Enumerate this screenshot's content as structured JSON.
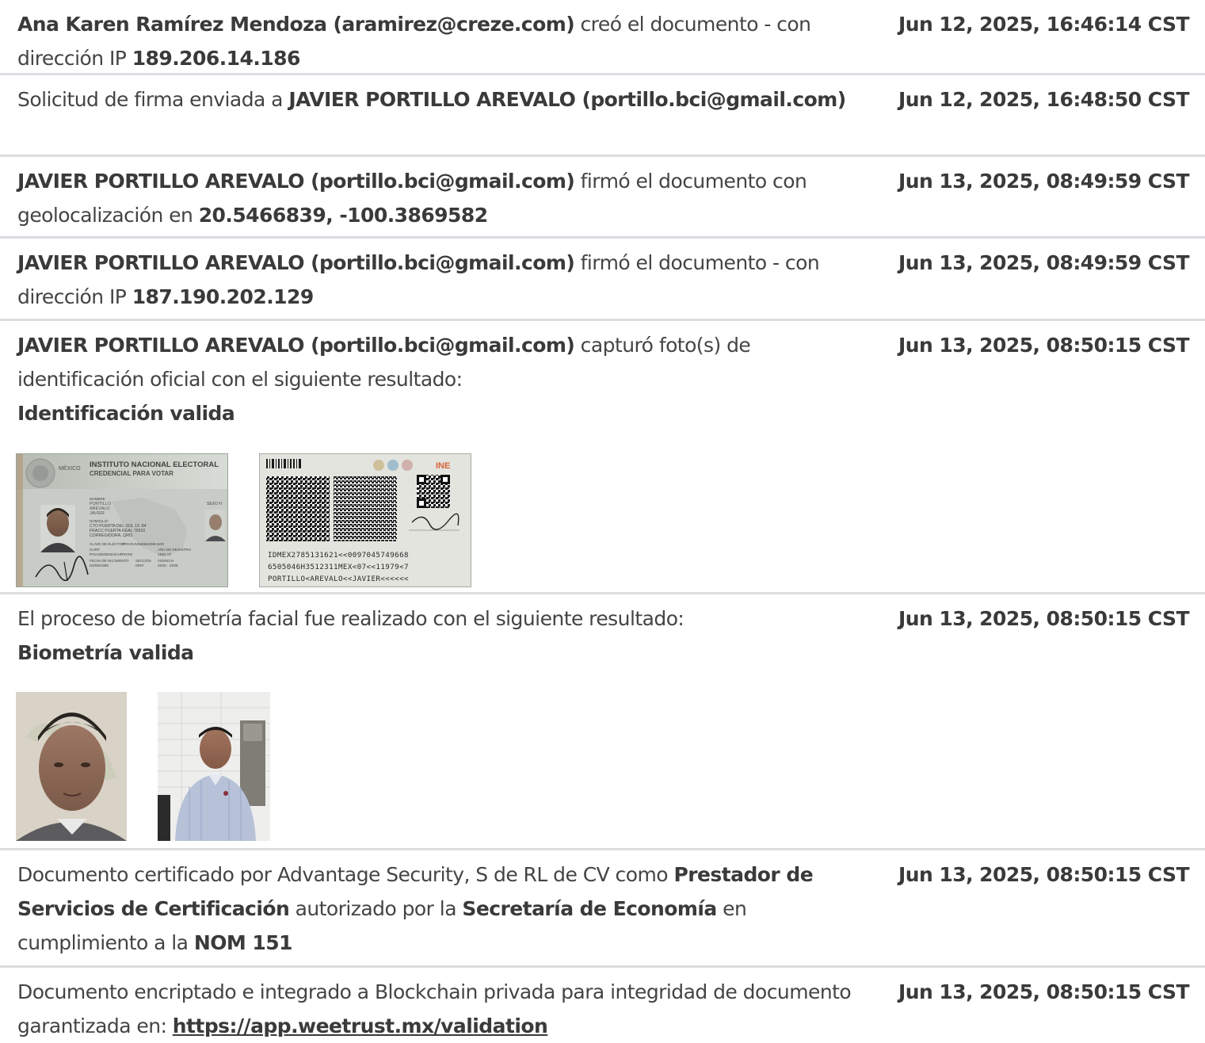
{
  "entries": [
    {
      "actor": "Ana Karen Ramírez Mendoza (aramirez@creze.com)",
      "action": " creó el documento - con dirección IP ",
      "ip": "189.206.14.186",
      "timestamp": "Jun 12, 2025, 16:46:14 CST"
    },
    {
      "action": "Solicitud de firma enviada a ",
      "recipient": "JAVIER PORTILLO AREVALO (portillo.bci@gmail.com)",
      "timestamp": "Jun 12, 2025, 16:48:50 CST"
    },
    {
      "actor": "JAVIER PORTILLO AREVALO (portillo.bci@gmail.com)",
      "action": " firmó el documento con geolocalización en ",
      "geo": "20.5466839, -100.3869582",
      "timestamp": "Jun 13, 2025, 08:49:59 CST"
    },
    {
      "actor": "JAVIER PORTILLO AREVALO (portillo.bci@gmail.com)",
      "action": " firmó el documento - con dirección IP ",
      "ip": "187.190.202.129",
      "timestamp": "Jun 13, 2025, 08:49:59 CST"
    },
    {
      "actor": "JAVIER PORTILLO AREVALO (portillo.bci@gmail.com)",
      "action": " capturó foto(s) de identificación oficial con el siguiente resultado:",
      "result": "Identificación valida",
      "timestamp": "Jun 13, 2025, 08:50:15 CST"
    },
    {
      "action": "El proceso de biometría facial fue realizado con el siguiente resultado:",
      "result": "Biometría valida",
      "timestamp": "Jun 13, 2025, 08:50:15 CST"
    },
    {
      "action_1": "Documento certificado por Advantage Security, S de RL de CV como ",
      "bold_1": "Prestador de Servicios de Certificación",
      "action_2": " autorizado por la ",
      "bold_2": "Secretaría de Economía",
      "action_3": " en cumplimiento a la ",
      "bold_3": "NOM 151",
      "timestamp": "Jun 13, 2025, 08:50:15 CST"
    },
    {
      "action": "Documento encriptado e integrado a Blockchain privada para integridad de documento garantizada en: ",
      "link": "https://app.weetrust.mx/validation",
      "timestamp": "Jun 13, 2025, 08:50:15 CST"
    }
  ],
  "id_card_front": {
    "country": "MÉXICO",
    "issuer": "INSTITUTO NACIONAL ELECTORAL",
    "doc_type": "CREDENCIAL PARA VOTAR",
    "name_label": "NOMBRE",
    "name_lines": [
      "PORTILLO",
      "AREVALO",
      "JAVIER"
    ],
    "sex_label": "SEXO H",
    "address_label": "DOMICILIO",
    "address_lines": [
      "CTO PUERTA DEL SOL 13 -84",
      "FRACC PUERTA REAL 76910",
      "CORREGIDORA, QRO."
    ],
    "elector_key_label": "CLAVE DE ELECTOR",
    "elector_key": "PRARJV65050408H100",
    "curp_label": "CURP",
    "curp": "POAJ650504HCHRRV02",
    "registration_label": "AÑO DE REGISTRO",
    "registration": "1991 07",
    "dob_label": "FECHA DE NACIMIENTO",
    "dob": "04/05/1965",
    "section_label": "SECCIÓN",
    "section": "0097",
    "validity_label": "VIGENCIA",
    "validity": "2025 - 2035"
  },
  "id_card_back": {
    "brand": "INE",
    "mrz": [
      "IDMEX2785131621<<0097045749668",
      "6505046H3512311MEX<07<<11979<7",
      "PORTILLO<AREVALO<<JAVIER<<<<<<"
    ]
  },
  "colors": {
    "text": "#444444",
    "divider": "#dcdce1"
  }
}
